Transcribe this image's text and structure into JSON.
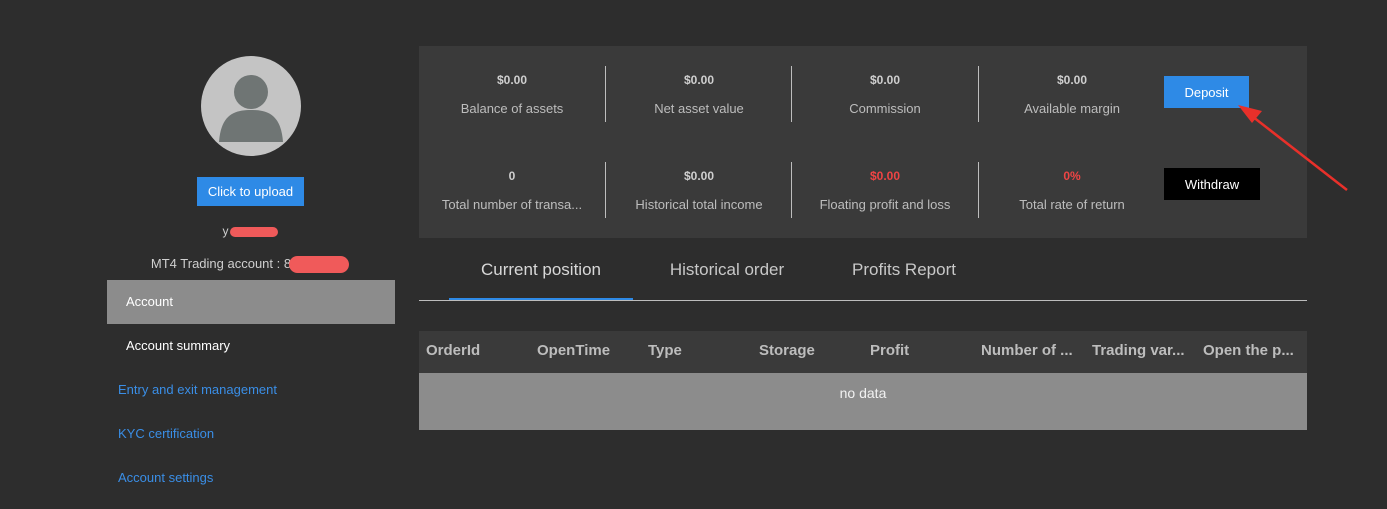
{
  "sidebar": {
    "upload_label": "Click to upload",
    "username_visible": "y",
    "mt4_label": "MT4 Trading account : 8",
    "menu": [
      {
        "label": "Account"
      },
      {
        "label": "Account summary"
      },
      {
        "label": "Entry and exit management"
      },
      {
        "label": "KYC certification"
      },
      {
        "label": "Account settings"
      }
    ]
  },
  "stats": {
    "row1": [
      {
        "value": "$0.00",
        "label": "Balance of assets"
      },
      {
        "value": "$0.00",
        "label": "Net asset value"
      },
      {
        "value": "$0.00",
        "label": "Commission"
      },
      {
        "value": "$0.00",
        "label": "Available margin"
      }
    ],
    "row2": [
      {
        "value": "0",
        "label": "Total number of transa..."
      },
      {
        "value": "$0.00",
        "label": "Historical total income"
      },
      {
        "value": "$0.00",
        "label": "Floating profit and loss"
      },
      {
        "value": "0%",
        "label": "Total rate of return"
      }
    ],
    "deposit_label": "Deposit",
    "withdraw_label": "Withdraw"
  },
  "tabs": [
    {
      "label": "Current position",
      "active": true
    },
    {
      "label": "Historical order"
    },
    {
      "label": "Profits Report"
    }
  ],
  "table": {
    "columns": [
      "OrderId",
      "OpenTime",
      "Type",
      "Storage",
      "Profit",
      "Number of ...",
      "Trading var...",
      "Open the p..."
    ],
    "empty_text": "no data"
  },
  "colors": {
    "accent": "#2e8ae6",
    "negative": "#ef4444",
    "annotation": "#e8302a",
    "redaction": "#f05a5a"
  }
}
